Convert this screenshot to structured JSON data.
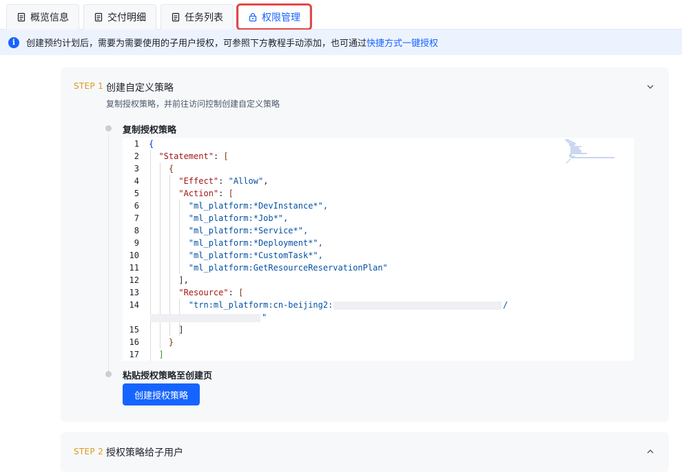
{
  "tabs": [
    {
      "label": "概览信息",
      "icon": "document-icon",
      "active": false
    },
    {
      "label": "交付明细",
      "icon": "document-icon",
      "active": false
    },
    {
      "label": "任务列表",
      "icon": "document-icon",
      "active": false
    },
    {
      "label": "权限管理",
      "icon": "lock-icon",
      "active": true
    }
  ],
  "banner": {
    "icon": "info-icon",
    "text": "创建预约计划后，需要为需要使用的子用户授权，可参照下方教程手动添加，也可通过",
    "link": "快捷方式一键授权"
  },
  "step1": {
    "step_label": "STEP 1",
    "title": "创建自定义策略",
    "description": "复制授权策略，并前往访问控制创建自定义策略",
    "copy_title": "复制授权策略",
    "paste_title": "粘贴授权策略至创建页",
    "button_label": "创建授权策略",
    "expanded": true
  },
  "step2": {
    "step_label": "STEP 2",
    "title": "授权策略给子用户",
    "expanded": false
  },
  "code": {
    "line_numbers": [
      "1",
      "2",
      "3",
      "4",
      "5",
      "6",
      "7",
      "8",
      "9",
      "10",
      "11",
      "12",
      "13",
      "14",
      "15",
      "16",
      "17"
    ],
    "lines": [
      "{",
      "  \"Statement\": [",
      "    {",
      "      \"Effect\": \"Allow\",",
      "      \"Action\": [",
      "        \"ml_platform:*DevInstance*\",",
      "        \"ml_platform:*Job*\",",
      "        \"ml_platform:*Service*\",",
      "        \"ml_platform:*Deployment*\",",
      "        \"ml_platform:*CustomTask*\",",
      "        \"ml_platform:GetResourceReservationPlan\"",
      "      ],",
      "      \"Resource\": [",
      "        \"trn:ml_platform:cn-beijing2:",
      "/",
      "\"",
      "      ]",
      "    }",
      "  ]"
    ]
  },
  "colors": {
    "accent": "#1664ff",
    "step_label": "#d99a24",
    "highlight_border": "#e0484a",
    "banner_bg": "#edf3fe"
  }
}
